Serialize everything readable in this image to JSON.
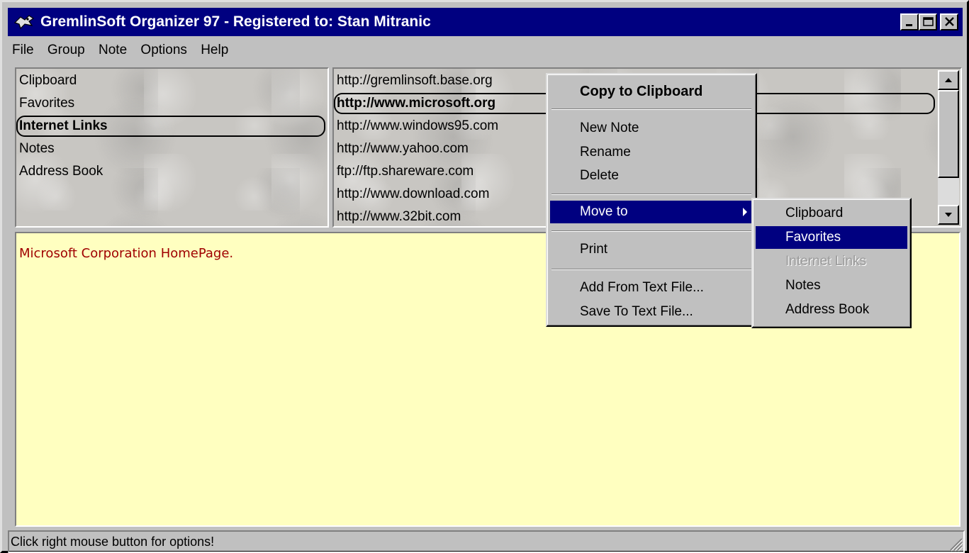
{
  "window": {
    "title": "GremlinSoft Organizer 97 - Registered to: Stan Mitranic",
    "title_bar_color": "#000080"
  },
  "menubar": {
    "items": [
      "File",
      "Group",
      "Note",
      "Options",
      "Help"
    ]
  },
  "groups": {
    "items": [
      "Clipboard",
      "Favorites",
      "Internet Links",
      "Notes",
      "Address Book"
    ],
    "selected": "Internet Links"
  },
  "notes_list": {
    "items": [
      "http://gremlinsoft.base.org",
      "http://www.microsoft.org",
      "http://www.windows95.com",
      "http://www.yahoo.com",
      "ftp://ftp.shareware.com",
      "http://www.download.com",
      "http://www.32bit.com"
    ],
    "selected": "http://www.microsoft.org"
  },
  "note_content": {
    "text": "Microsoft Corporation HomePage.",
    "background": "#ffffc0",
    "text_color": "#a00000"
  },
  "context_menu": {
    "copy": "Copy to Clipboard",
    "new_note": "New Note",
    "rename": "Rename",
    "delete": "Delete",
    "move_to": "Move to",
    "print": "Print",
    "add_from_file": "Add From Text File...",
    "save_to_file": "Save To Text File..."
  },
  "submenu": {
    "items": [
      "Clipboard",
      "Favorites",
      "Internet Links",
      "Notes",
      "Address Book"
    ],
    "highlighted": "Favorites",
    "disabled": "Internet Links"
  },
  "statusbar": {
    "text": "Click right mouse button for options!"
  },
  "colors": {
    "highlight": "#000080",
    "face": "#c0c0c0"
  }
}
